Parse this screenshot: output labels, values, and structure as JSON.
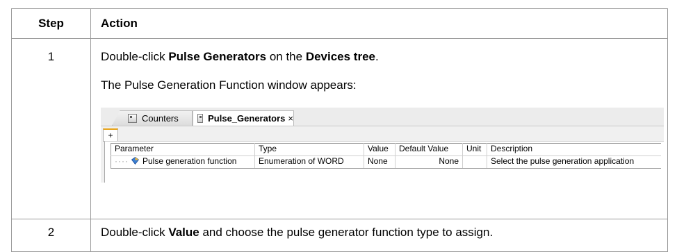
{
  "headers": {
    "step": "Step",
    "action": "Action"
  },
  "rows": [
    {
      "step": "1",
      "line1": {
        "pre": "Double-click ",
        "b1": "Pulse Generators",
        "mid": " on the ",
        "b2": "Devices tree",
        "post": "."
      },
      "line2": "The Pulse Generation Function window appears:"
    },
    {
      "step": "2",
      "line": {
        "pre": "Double-click ",
        "b1": "Value",
        "post": " and choose the pulse generator function type to assign."
      }
    }
  ],
  "screenshot": {
    "tabs": [
      {
        "label": "Counters",
        "icon": "module-icon",
        "active": false
      },
      {
        "label": "Pulse_Generators",
        "icon": "module-icon",
        "active": true,
        "close": "×"
      }
    ],
    "add_tab": "+",
    "grid": {
      "headers": [
        "Parameter",
        "Type",
        "Value",
        "Default Value",
        "Unit",
        "Description"
      ],
      "row": {
        "tree": "····",
        "icon": "parameter-icon",
        "parameter": "Pulse generation function",
        "type": "Enumeration of WORD",
        "value": "None",
        "default": "None",
        "unit": "",
        "description": "Select the pulse generation application"
      }
    }
  }
}
